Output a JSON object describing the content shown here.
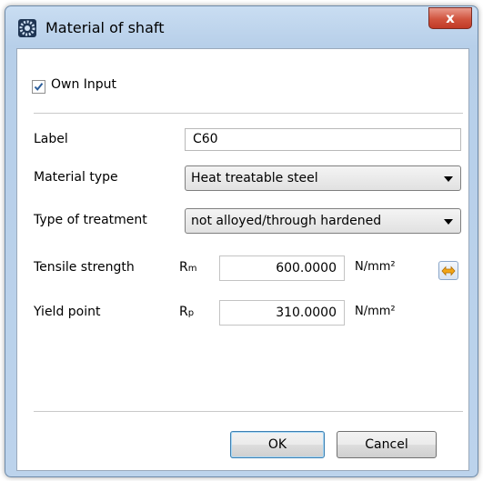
{
  "window": {
    "title": "Material of shaft",
    "close_symbol": "x",
    "icon": "gear-app-icon"
  },
  "own_input": {
    "label": "Own Input",
    "checked": true
  },
  "form": {
    "label_label": "Label",
    "label_value": "C60",
    "material_type_label": "Material type",
    "material_type_value": "Heat treatable steel",
    "treatment_label": "Type of treatment",
    "treatment_value": "not alloyed/through hardened",
    "tensile_label": "Tensile strength",
    "tensile_symbol": "R",
    "tensile_symbol_sub": "m",
    "tensile_value": "600.0000",
    "tensile_unit": "N/mm²",
    "yield_label": "Yield point",
    "yield_symbol": "R",
    "yield_symbol_sub": "p",
    "yield_value": "310.0000",
    "yield_unit": "N/mm²",
    "swap_icon": "swap-arrows-icon"
  },
  "buttons": {
    "ok": "OK",
    "cancel": "Cancel"
  },
  "colors": {
    "accent_orange": "#f2a516",
    "titlebar": "#bcd3ec",
    "close_red": "#c94a37"
  }
}
